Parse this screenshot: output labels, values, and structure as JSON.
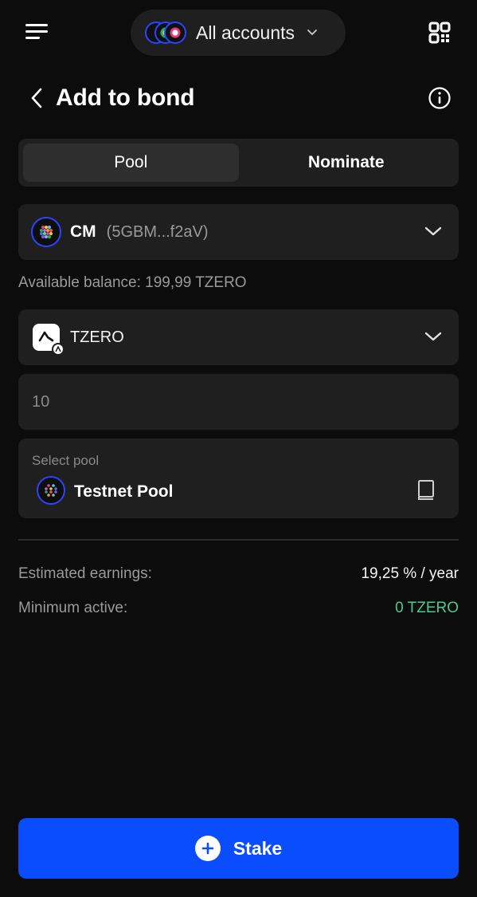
{
  "top_bar": {
    "account_switcher_label": "All accounts",
    "icons": [
      "menu-icon",
      "chevron-down-icon",
      "qr-code-icon"
    ]
  },
  "header": {
    "title": "Add to bond",
    "icons": [
      "chevron-left-icon",
      "info-icon"
    ]
  },
  "tabs": [
    {
      "label": "Pool",
      "active": true
    },
    {
      "label": "Nominate",
      "active": false
    }
  ],
  "account": {
    "name": "CM",
    "address": "(5GBM...f2aV)"
  },
  "balance": {
    "label": "Available balance:",
    "value": "199,99 TZERO"
  },
  "token": {
    "name": "TZERO"
  },
  "amount": {
    "value": "10"
  },
  "pool": {
    "label": "Select pool",
    "name": "Testnet Pool"
  },
  "estimates": {
    "earnings_label": "Estimated earnings:",
    "earnings_value": "19,25 % / year",
    "minimum_label": "Minimum active:",
    "minimum_value": "0 TZERO"
  },
  "action": {
    "stake_label": "Stake"
  },
  "colors": {
    "background": "#0c0c0c",
    "card": "#1f1f1f",
    "accent_blue": "#0a4dff",
    "success_green": "#4ccb8e",
    "muted_text": "#9a9a9a"
  }
}
